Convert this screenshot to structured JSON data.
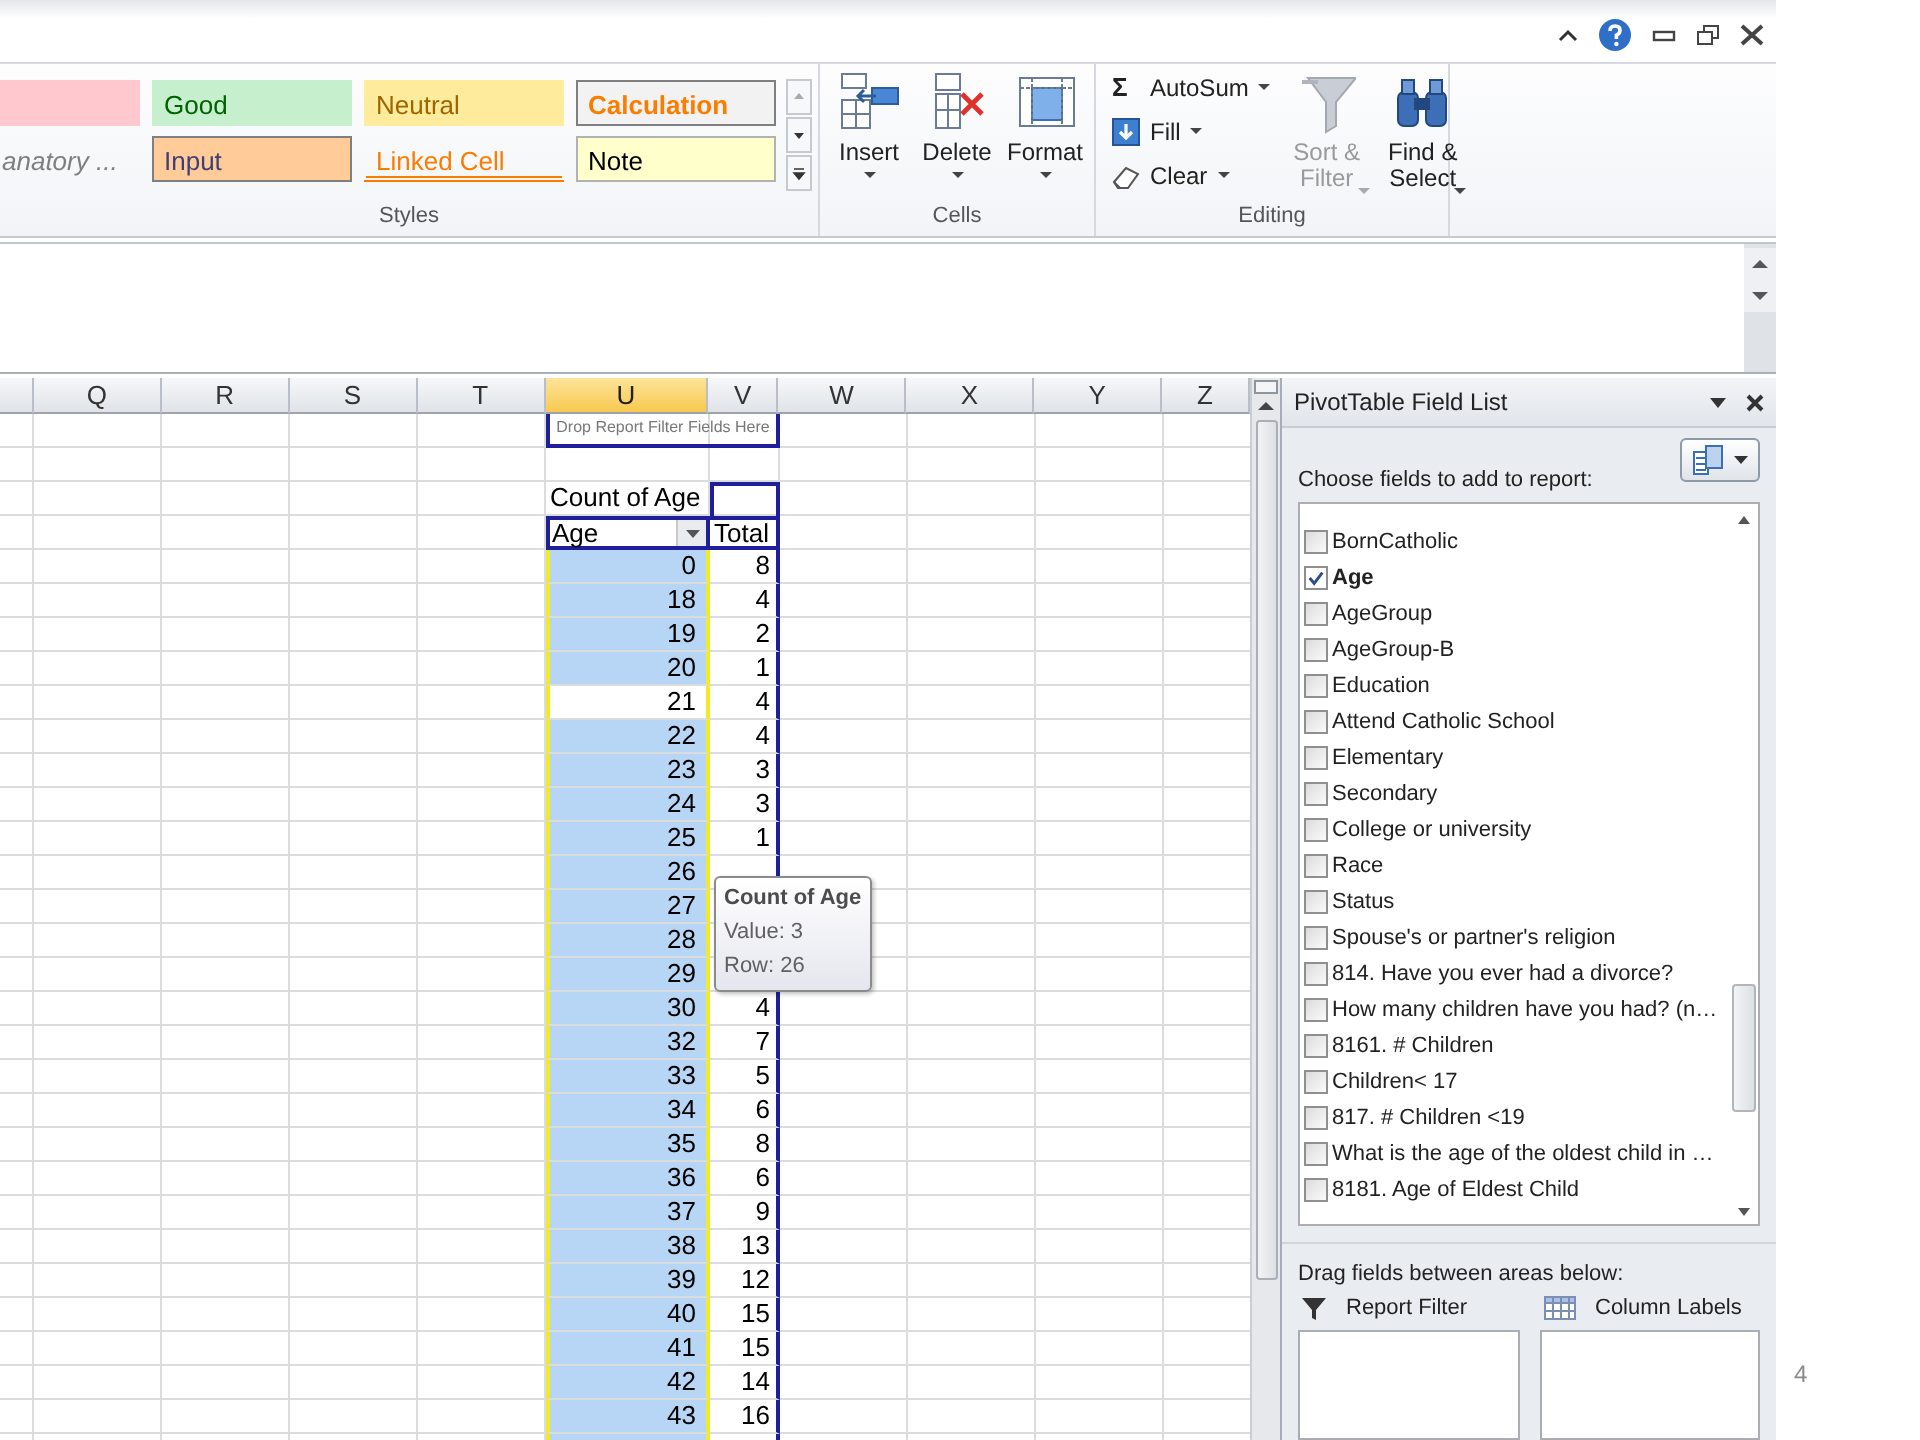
{
  "ribbon": {
    "styles": {
      "label": "Styles",
      "cells": [
        {
          "kind": "bad"
        },
        {
          "kind": "good",
          "text": "Good"
        },
        {
          "kind": "neutral",
          "text": "Neutral"
        },
        {
          "kind": "calculation",
          "text": "Calculation"
        },
        {
          "kind": "explanatory",
          "text": "anatory ..."
        },
        {
          "kind": "input",
          "text": "Input"
        },
        {
          "kind": "linked",
          "text": "Linked Cell"
        },
        {
          "kind": "note",
          "text": "Note"
        }
      ]
    },
    "cells": {
      "label": "Cells",
      "buttons": [
        {
          "kind": "insert",
          "label": "Insert"
        },
        {
          "kind": "delete",
          "label": "Delete"
        },
        {
          "kind": "format",
          "label": "Format"
        }
      ]
    },
    "editing": {
      "label": "Editing",
      "small_buttons": [
        {
          "kind": "sum",
          "symbol": "Σ",
          "label": "AutoSum"
        },
        {
          "kind": "fill",
          "label": "Fill"
        },
        {
          "kind": "clear",
          "label": "Clear"
        }
      ],
      "big_buttons": [
        {
          "kind": "sort",
          "label": "Sort &\nFilter",
          "disabled": true
        },
        {
          "kind": "find",
          "label": "Find &\nSelect",
          "disabled": false
        }
      ]
    }
  },
  "columns": [
    {
      "label": "Q",
      "selected": false
    },
    {
      "label": "R",
      "selected": false
    },
    {
      "label": "S",
      "selected": false
    },
    {
      "label": "T",
      "selected": false
    },
    {
      "label": "U",
      "selected": true
    },
    {
      "label": "V",
      "selected": false
    },
    {
      "label": "W",
      "selected": false
    },
    {
      "label": "X",
      "selected": false
    },
    {
      "label": "Y",
      "selected": false
    },
    {
      "label": "Z",
      "selected": false
    }
  ],
  "pivot": {
    "filter_drop": "Drop Report Filter Fields Here",
    "value_title": "Count of Age",
    "row_header": "Age",
    "total_header": "Total",
    "rows": [
      {
        "label": "0",
        "value": "8",
        "highlighted": true
      },
      {
        "label": "18",
        "value": "4",
        "highlighted": true
      },
      {
        "label": "19",
        "value": "2",
        "highlighted": true
      },
      {
        "label": "20",
        "value": "1",
        "highlighted": true
      },
      {
        "label": "21",
        "value": "4",
        "highlighted": false
      },
      {
        "label": "22",
        "value": "4",
        "highlighted": true
      },
      {
        "label": "23",
        "value": "3",
        "highlighted": true
      },
      {
        "label": "24",
        "value": "3",
        "highlighted": true
      },
      {
        "label": "25",
        "value": "1",
        "highlighted": true
      },
      {
        "label": "26",
        "highlighted": true
      },
      {
        "label": "27",
        "highlighted": true
      },
      {
        "label": "28",
        "highlighted": true
      },
      {
        "label": "29",
        "highlighted": true
      },
      {
        "label": "30",
        "value": "4",
        "highlighted": true
      },
      {
        "label": "32",
        "value": "7",
        "highlighted": true
      },
      {
        "label": "33",
        "value": "5",
        "highlighted": true
      },
      {
        "label": "34",
        "value": "6",
        "highlighted": true
      },
      {
        "label": "35",
        "value": "8",
        "highlighted": true
      },
      {
        "label": "36",
        "value": "6",
        "highlighted": true
      },
      {
        "label": "37",
        "value": "9",
        "highlighted": true
      },
      {
        "label": "38",
        "value": "13",
        "highlighted": true
      },
      {
        "label": "39",
        "value": "12",
        "highlighted": true
      },
      {
        "label": "40",
        "value": "15",
        "highlighted": true
      },
      {
        "label": "41",
        "value": "15",
        "highlighted": true
      },
      {
        "label": "42",
        "value": "14",
        "highlighted": true
      },
      {
        "label": "43",
        "value": "16",
        "highlighted": true
      }
    ]
  },
  "tooltip": {
    "title": "Count of Age",
    "lines": [
      "Value: 3",
      "Row: 26"
    ]
  },
  "field_list": {
    "title": "PivotTable Field List",
    "prompt": "Choose fields to add to report:",
    "fields": [
      {
        "name": "BornCatholic",
        "checked": false
      },
      {
        "name": "Age",
        "checked": true
      },
      {
        "name": "AgeGroup",
        "checked": false
      },
      {
        "name": "AgeGroup-B",
        "checked": false
      },
      {
        "name": "Education",
        "checked": false
      },
      {
        "name": "Attend Catholic School",
        "checked": false
      },
      {
        "name": "Elementary",
        "checked": false
      },
      {
        "name": "Secondary",
        "checked": false
      },
      {
        "name": "College or university",
        "checked": false
      },
      {
        "name": "Race",
        "checked": false
      },
      {
        "name": "Status",
        "checked": false
      },
      {
        "name": "Spouse's or partner's religion",
        "checked": false
      },
      {
        "name": "814. Have you ever had a divorce?",
        "checked": false
      },
      {
        "name": "How many children have you had? (n…",
        "checked": false
      },
      {
        "name": "8161. # Children",
        "checked": false
      },
      {
        "name": "Children< 17",
        "checked": false
      },
      {
        "name": "817. # Children <19",
        "checked": false
      },
      {
        "name": "What is the age of the oldest child in …",
        "checked": false
      },
      {
        "name": "8181. Age of Eldest Child",
        "checked": false
      }
    ],
    "drag_prompt": "Drag fields between areas below:",
    "areas": [
      {
        "kind": "filter",
        "label": "Report Filter"
      },
      {
        "kind": "columns",
        "label": "Column Labels"
      }
    ]
  },
  "page_number": "4"
}
